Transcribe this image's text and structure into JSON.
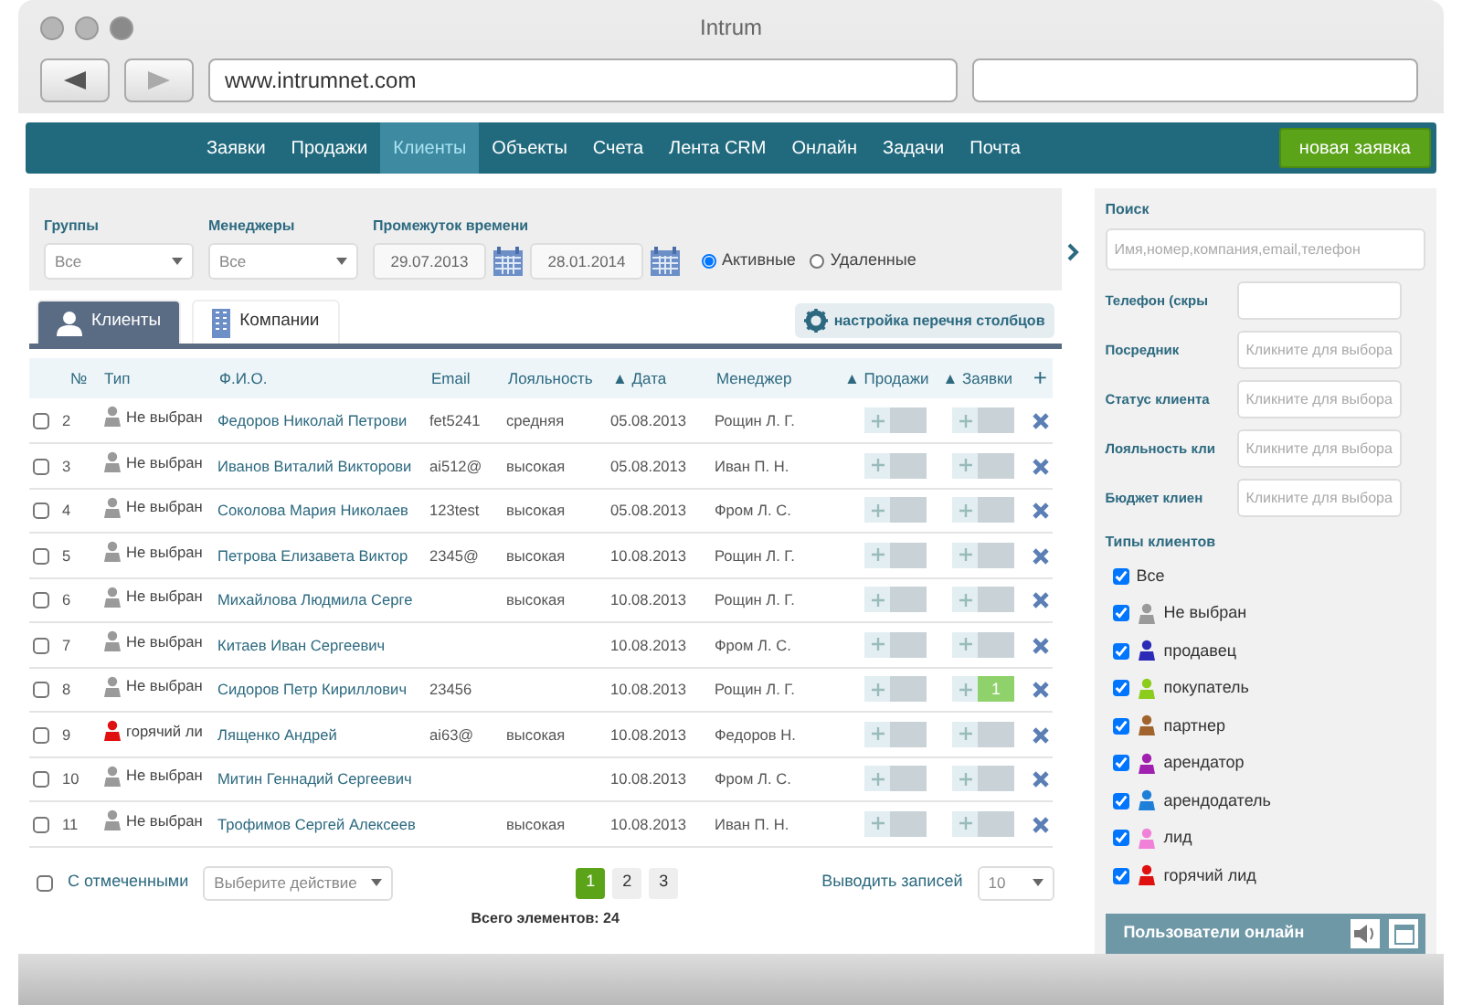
{
  "window": {
    "title": "Intrum",
    "address": "www.intrumnet.com"
  },
  "nav": {
    "items": [
      {
        "label": "Заявки",
        "selected": false
      },
      {
        "label": "Продажи",
        "selected": false
      },
      {
        "label": "Клиенты",
        "selected": true
      },
      {
        "label": "Объекты",
        "selected": false
      },
      {
        "label": "Счета",
        "selected": false
      },
      {
        "label": "Лента CRM",
        "selected": false
      },
      {
        "label": "Онлайн",
        "selected": false
      },
      {
        "label": "Задачи",
        "selected": false
      },
      {
        "label": "Почта",
        "selected": false
      }
    ],
    "action": "новая заявка"
  },
  "filters": {
    "groups": {
      "label": "Группы",
      "value": "Все"
    },
    "managers": {
      "label": "Менеджеры",
      "value": "Все"
    },
    "period": {
      "label": "Промежуток времени",
      "from": "29.07.2013",
      "to": "28.01.2014"
    },
    "status": [
      {
        "label": "Активные",
        "selected": true
      },
      {
        "label": "Удаленные",
        "selected": false
      }
    ]
  },
  "tabs": [
    {
      "label": "Клиенты",
      "selected": true
    },
    {
      "label": "Компании",
      "selected": false
    }
  ],
  "columns_button": "настройка перечня столбцов",
  "table": {
    "columns": [
      "№",
      "Тип",
      "Ф.И.О.",
      "Email",
      "Лояльность",
      "▲ Дата",
      "Менеджер",
      "▲ Продажи",
      "▲ Заявки",
      "+"
    ],
    "rows": [
      {
        "checked": false,
        "num": "2",
        "type": "Не выбран",
        "color": "#9a9a9a",
        "name": "Федоров Николай Петрови",
        "email": "fet5241",
        "loyalty": "средняя",
        "date": "05.08.2013",
        "manager": "Рощин Л. Г."
      },
      {
        "checked": false,
        "num": "3",
        "type": "Не выбран",
        "color": "#9a9a9a",
        "name": "Иванов Виталий Викторови",
        "email": "ai512@",
        "loyalty": "высокая",
        "date": "05.08.2013",
        "manager": "Иван П. Н."
      },
      {
        "checked": false,
        "num": "4",
        "type": "Не выбран",
        "color": "#9a9a9a",
        "name": "Соколова Мария Николаев",
        "email": "123test",
        "loyalty": "высокая",
        "date": "05.08.2013",
        "manager": "Фром Л. С."
      },
      {
        "checked": false,
        "num": "5",
        "type": "Не выбран",
        "color": "#9a9a9a",
        "name": "Петрова Елизавета Виктор",
        "email": "2345@",
        "loyalty": "высокая",
        "date": "10.08.2013",
        "manager": "Рощин Л. Г."
      },
      {
        "checked": false,
        "num": "6",
        "type": "Не выбран",
        "color": "#9a9a9a",
        "name": "Михайлова Людмила Серге",
        "loyalty": "высокая",
        "date": "10.08.2013",
        "manager": "Рощин Л. Г."
      },
      {
        "checked": false,
        "num": "7",
        "type": "Не выбран",
        "color": "#9a9a9a",
        "name": "Китаев Иван Сергеевич",
        "date": "10.08.2013",
        "manager": "Фром Л. С."
      },
      {
        "checked": false,
        "num": "8",
        "type": "Не выбран",
        "color": "#9a9a9a",
        "name": "Сидоров Петр Кириллович",
        "email": "23456",
        "date": "10.08.2013",
        "manager": "Рощин Л. Г.",
        "orders": "1"
      },
      {
        "checked": false,
        "num": "9",
        "type": "горячий ли",
        "color": "#e01010",
        "name": "Лященко Андрей",
        "email": "ai63@",
        "loyalty": "высокая",
        "date": "10.08.2013",
        "manager": "Федоров Н."
      },
      {
        "checked": false,
        "num": "10",
        "type": "Не выбран",
        "color": "#9a9a9a",
        "name": "Митин Геннадий Сергеевич",
        "date": "10.08.2013",
        "manager": "Фром Л. С."
      },
      {
        "checked": false,
        "num": "11",
        "type": "Не выбран",
        "color": "#9a9a9a",
        "name": "Трофимов Сергей Алексеев",
        "loyalty": "высокая",
        "date": "10.08.2013",
        "manager": "Иван П. Н."
      }
    ]
  },
  "footer": {
    "select_all": {
      "checked": false,
      "label": "С отмеченными"
    },
    "action_placeholder": "Выберите действие",
    "pages": [
      {
        "label": "1",
        "selected": true
      },
      {
        "label": "2",
        "selected": false
      },
      {
        "label": "3",
        "selected": false
      }
    ],
    "per_page_label": "Выводить записей",
    "per_page": "10",
    "total": "Всего элементов: 24"
  },
  "sidebar": {
    "search": {
      "label": "Поиск",
      "placeholder": "Имя,номер,компания,email,телефон"
    },
    "fields": [
      {
        "label": "Телефон (скры"
      },
      {
        "label": "Посредник",
        "placeholder": "Кликните для выбора"
      },
      {
        "label": "Статус клиента",
        "placeholder": "Кликните для выбора"
      },
      {
        "label": "Лояльность кли",
        "placeholder": "Кликните для выбора"
      },
      {
        "label": "Бюджет клиен",
        "placeholder": "Кликните для выбора"
      }
    ],
    "types_label": "Типы клиентов",
    "types": [
      {
        "label": "Все",
        "checked": true
      },
      {
        "label": "Не выбран",
        "checked": true,
        "color": "#9a9a9a"
      },
      {
        "label": "продавец",
        "checked": true,
        "color": "#2b2bb8"
      },
      {
        "label": "покупатель",
        "checked": true,
        "color": "#8ccc1c"
      },
      {
        "label": "партнер",
        "checked": true,
        "color": "#a0642c"
      },
      {
        "label": "арендатор",
        "checked": true,
        "color": "#a020b0"
      },
      {
        "label": "арендодатель",
        "checked": true,
        "color": "#1e7fd8"
      },
      {
        "label": "лид",
        "checked": true,
        "color": "#f080d8"
      },
      {
        "label": "горячий лид",
        "checked": true,
        "color": "#e01010"
      }
    ],
    "online_users": "Пользователи онлайн"
  }
}
